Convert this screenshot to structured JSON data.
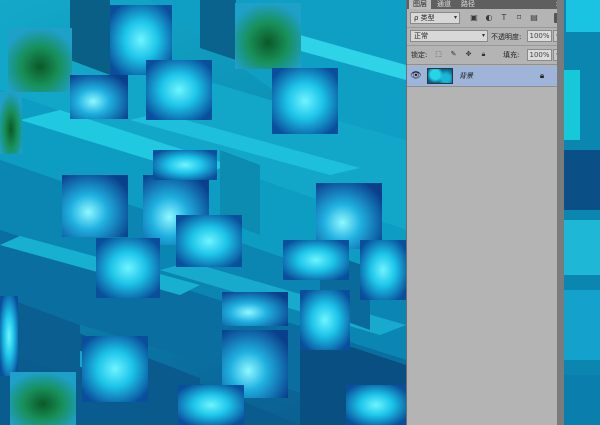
{
  "panel": {
    "tabs": [
      {
        "label": "图层",
        "active": true
      },
      {
        "label": "通道",
        "active": false
      },
      {
        "label": "路径",
        "active": false
      }
    ],
    "close_glyph": "×",
    "filter": {
      "kind_label": "ρ 类型",
      "icons": [
        "image-filter-icon",
        "adjustment-filter-icon",
        "type-filter-icon",
        "shape-filter-icon",
        "smart-object-filter-icon"
      ]
    },
    "blend": {
      "mode": "正常",
      "opacity_label": "不透明度:",
      "opacity_value": "100%"
    },
    "lock": {
      "label": "锁定:",
      "fill_label": "填充:",
      "fill_value": "100%"
    },
    "layers": [
      {
        "name": "背景",
        "visible": true,
        "locked": true
      }
    ]
  },
  "colors": {
    "panel_bg": "#b4b4b4",
    "selected_layer": "#9fb4d9",
    "canvas_primary": "#0c8fb5",
    "canvas_dark": "#0a5a8c",
    "canvas_highlight": "#19e0f0"
  }
}
